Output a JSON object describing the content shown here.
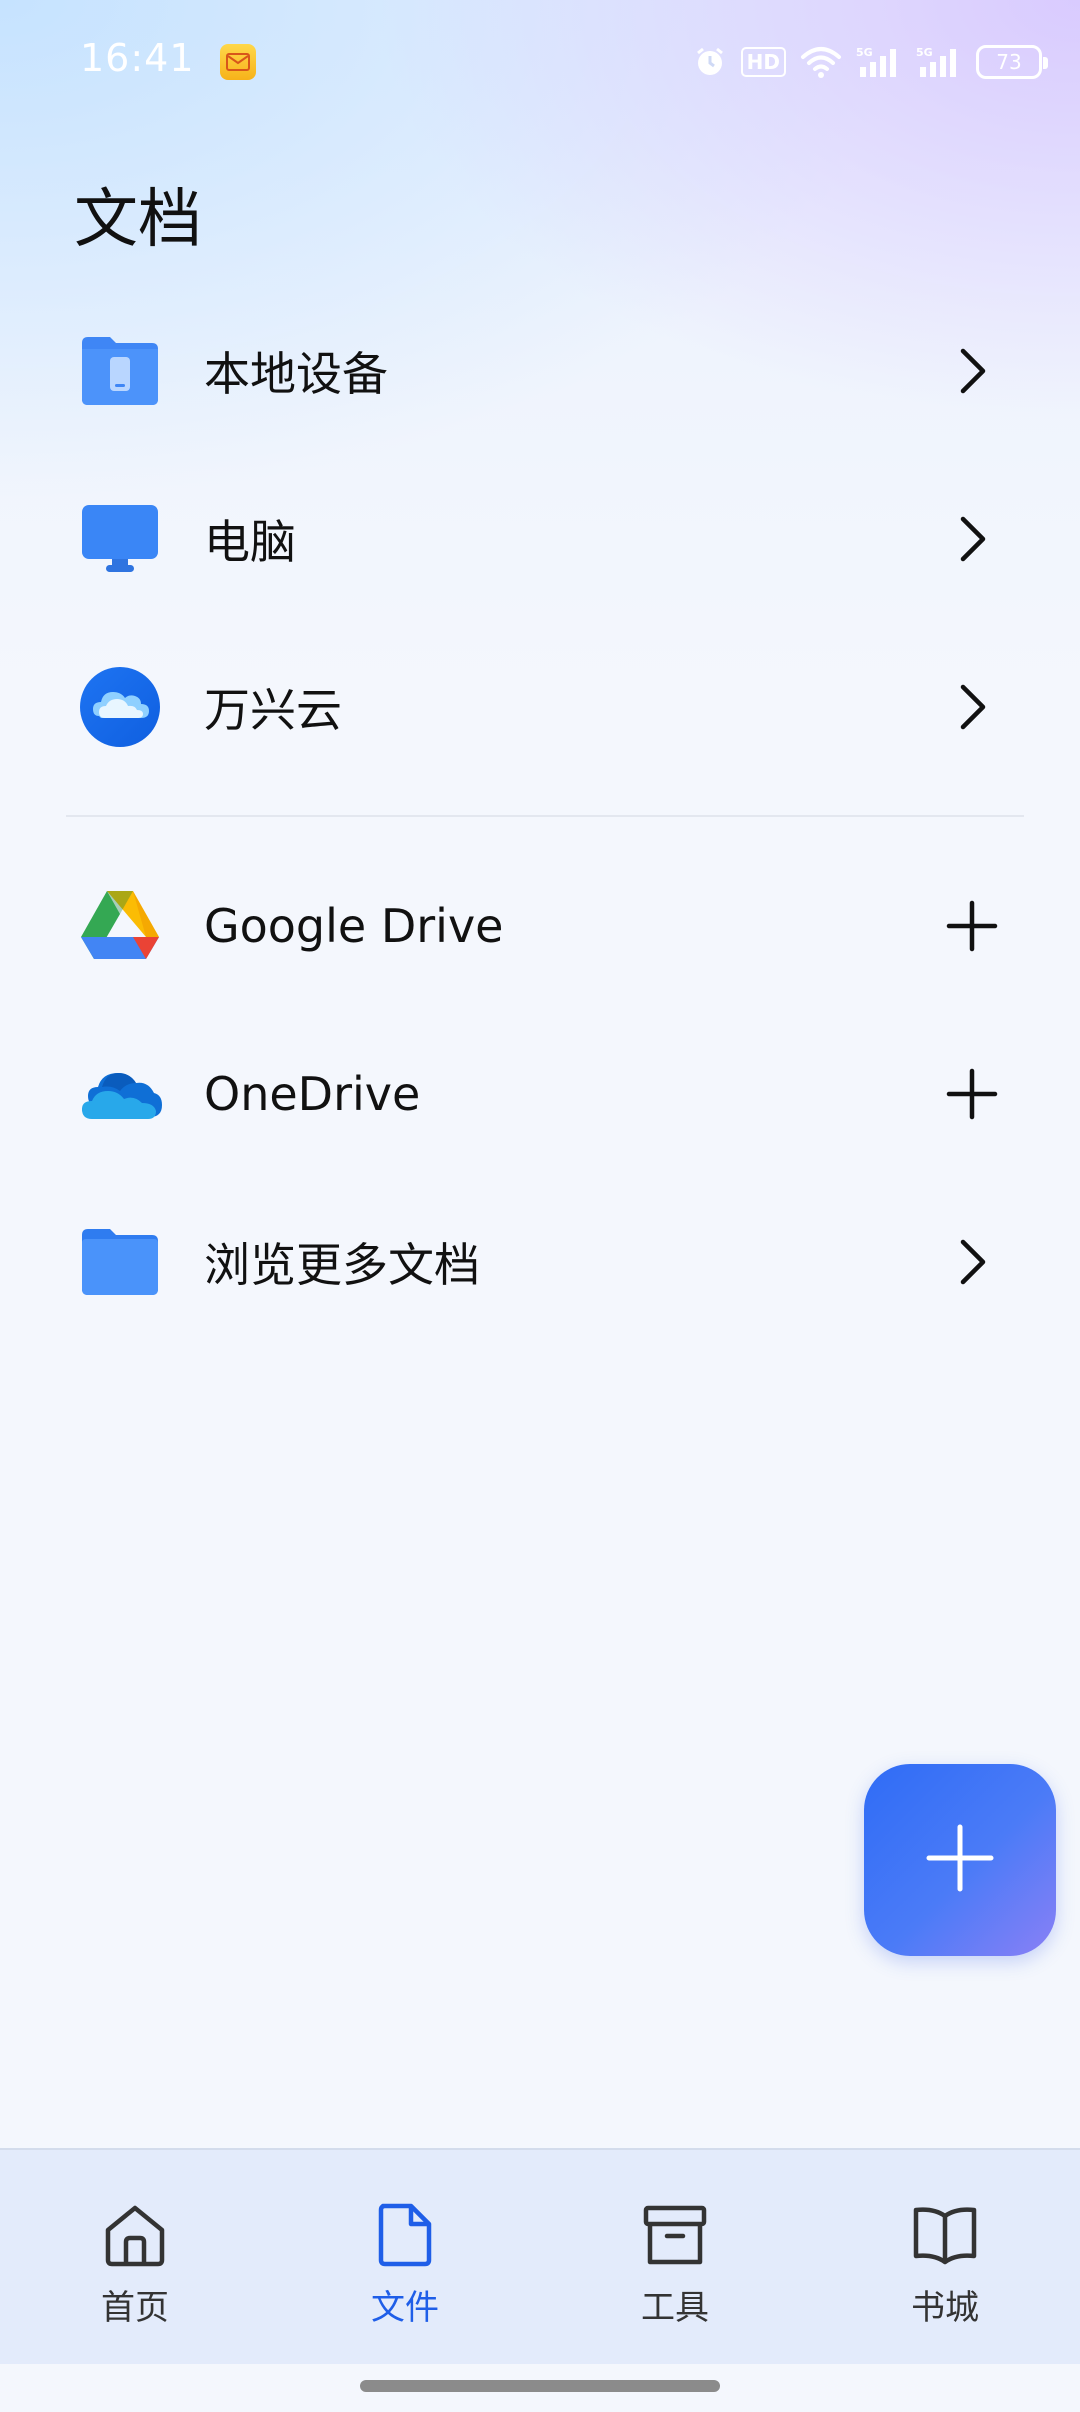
{
  "status_bar": {
    "time": "16:41",
    "hd_label": "HD",
    "battery_level": "73",
    "icons": [
      "mail-icon",
      "alarm-icon",
      "hd-icon",
      "wifi-icon",
      "signal-5g-icon",
      "signal-5g-icon",
      "battery-icon"
    ]
  },
  "page": {
    "title": "文档"
  },
  "locations": [
    {
      "label": "本地设备",
      "icon": "local-device-icon",
      "action": "chevron-right-icon"
    },
    {
      "label": "电脑",
      "icon": "computer-icon",
      "action": "chevron-right-icon"
    },
    {
      "label": "万兴云",
      "icon": "wondershare-cloud-icon",
      "action": "chevron-right-icon"
    }
  ],
  "cloud_services": [
    {
      "label": "Google Drive",
      "icon": "google-drive-icon",
      "action": "plus-icon"
    },
    {
      "label": "OneDrive",
      "icon": "onedrive-icon",
      "action": "plus-icon"
    },
    {
      "label": "浏览更多文档",
      "icon": "folder-icon",
      "action": "chevron-right-icon"
    }
  ],
  "fab": {
    "icon": "plus-icon"
  },
  "bottom_nav": {
    "items": [
      {
        "label": "首页",
        "icon": "home-icon",
        "active": false
      },
      {
        "label": "文件",
        "icon": "document-icon",
        "active": true
      },
      {
        "label": "工具",
        "icon": "toolbox-icon",
        "active": false
      },
      {
        "label": "书城",
        "icon": "book-icon",
        "active": false
      }
    ]
  },
  "colors": {
    "accent": "#1f5ee8",
    "fab_start": "#2f6cf6",
    "fab_end": "#8a80f6",
    "nav_background": "#e3ebfb"
  }
}
